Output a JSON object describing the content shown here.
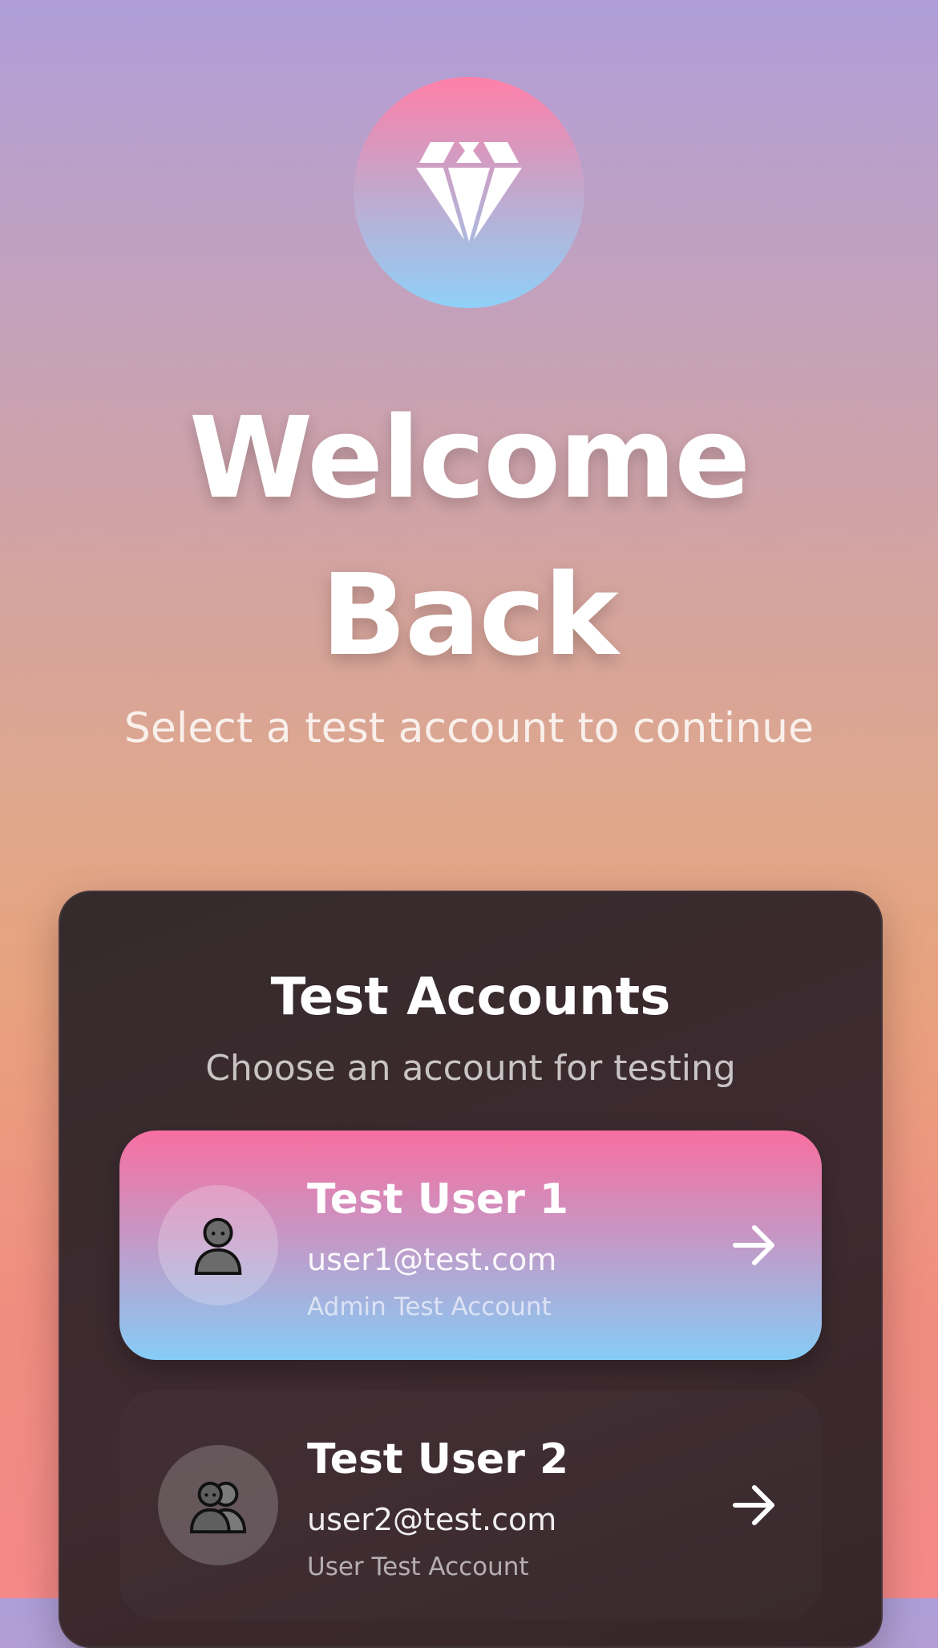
{
  "header": {
    "logo_icon": "diamond-icon",
    "title_line1": "Welcome",
    "title_line2": "Back",
    "subtitle": "Select a test account to continue"
  },
  "panel": {
    "title": "Test Accounts",
    "subtitle": "Choose an account for testing",
    "accounts": [
      {
        "name": "Test User 1",
        "email": "user1@test.com",
        "role": "Admin Test Account",
        "avatar_icon": "person-icon",
        "selected": true
      },
      {
        "name": "Test User 2",
        "email": "user2@test.com",
        "role": "User Test Account",
        "avatar_icon": "two-people-icon",
        "selected": false
      }
    ]
  },
  "colors": {
    "background_top": "#af9ed9",
    "background_bottom": "#f48988",
    "accent_pink": "#f76fa0",
    "accent_blue": "#85ccf6",
    "panel": "#3a2a2e"
  }
}
